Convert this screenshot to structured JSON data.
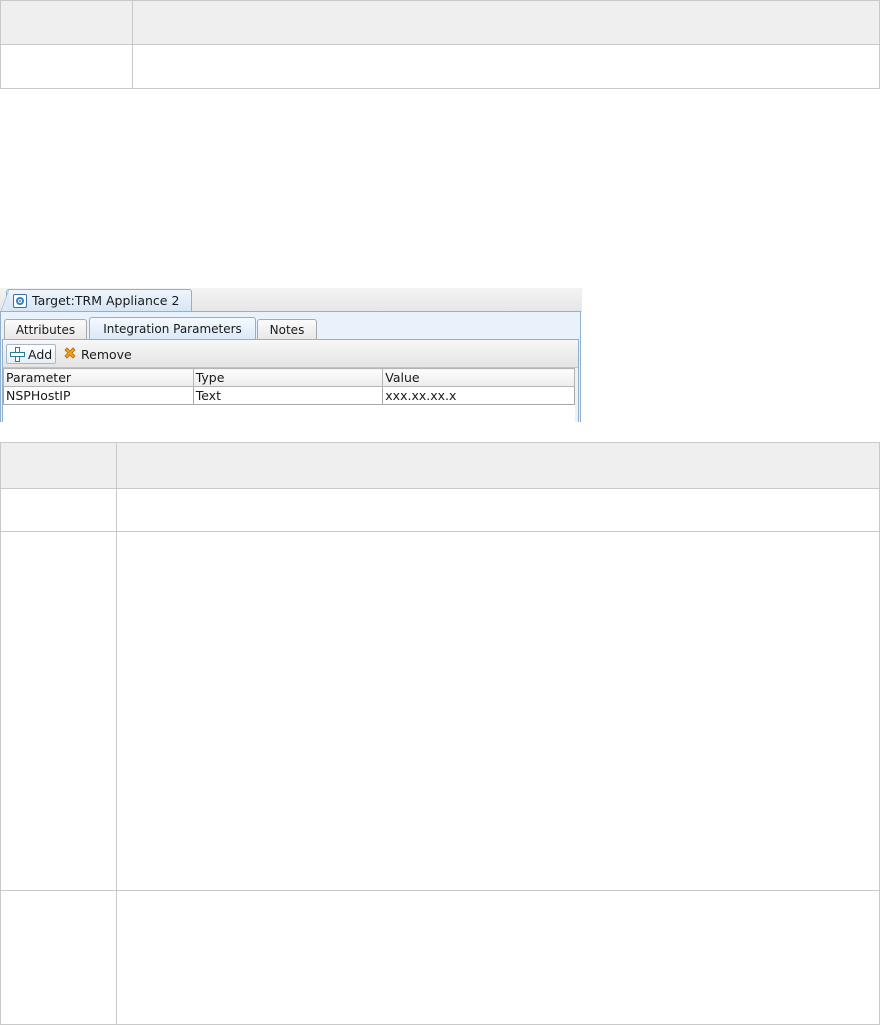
{
  "app": {
    "window_tab_label": "Target:TRM Appliance 2",
    "tabs": [
      {
        "label": "Attributes",
        "active": false
      },
      {
        "label": "Integration Parameters",
        "active": true
      },
      {
        "label": "Notes",
        "active": false
      }
    ],
    "toolbar": {
      "add_label": "Add",
      "remove_label": "Remove"
    },
    "grid": {
      "columns": [
        "Parameter",
        "Type",
        "Value"
      ],
      "rows": [
        [
          "NSPHostIP",
          "Text",
          "xxx.xx.xx.x"
        ]
      ]
    },
    "icons": {
      "window_tab": "target-icon",
      "add": "plus-icon",
      "remove": "x-icon"
    },
    "colors": {
      "tab_accent": "#8fb0d0",
      "panel_bg": "#e9f1fa",
      "table_header_bg": "#efefef",
      "remove_icon": "#f0a020"
    }
  }
}
